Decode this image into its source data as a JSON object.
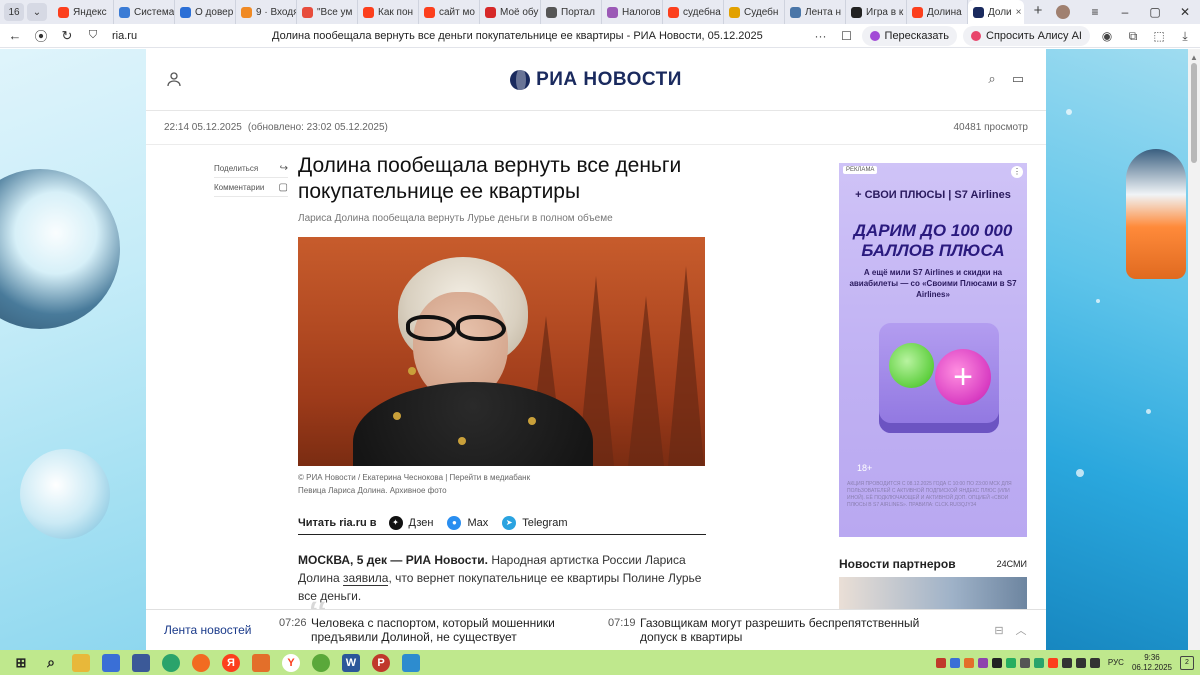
{
  "browser": {
    "tab_count": "16",
    "tabs": [
      {
        "label": "Яндекс",
        "color": "#fc3f1d"
      },
      {
        "label": "Система",
        "color": "#3a7bd5"
      },
      {
        "label": "О довер",
        "color": "#2b6fd6"
      },
      {
        "label": "9 · Входя",
        "color": "#f08a24"
      },
      {
        "label": "\"Все ум",
        "color": "#e74c3c"
      },
      {
        "label": "Как пон",
        "color": "#fc3f1d"
      },
      {
        "label": "сайт мо",
        "color": "#fc3f1d"
      },
      {
        "label": "Моё обу",
        "color": "#d62828"
      },
      {
        "label": "Портал",
        "color": "#555555"
      },
      {
        "label": "Налогов",
        "color": "#9b59b6"
      },
      {
        "label": "судебна",
        "color": "#fc3f1d"
      },
      {
        "label": "Судебн",
        "color": "#e2a100"
      },
      {
        "label": "Лента н",
        "color": "#4a76a8"
      },
      {
        "label": "Игра в к",
        "color": "#222222"
      },
      {
        "label": "Долина",
        "color": "#fc3f1d"
      }
    ],
    "active_tab": {
      "label": "Доли",
      "close": "×"
    },
    "new_tab": "+",
    "url": "ria.ru",
    "page_title": "Долина пообещала вернуть все деньги покупательнице ее квартиры - РИА Новости, 05.12.2025",
    "translate_label": "Пересказать",
    "alice_label": "Спросить Алису AI",
    "more": "···"
  },
  "site": {
    "logo_text": "РИА НОВОСТИ",
    "published": "22:14 05.12.2025",
    "updated": "(обновлено: 23:02 05.12.2025)",
    "views": "40481",
    "views_label": "просмотр",
    "share_label": "Поделиться",
    "comments_label": "Комментарии"
  },
  "article": {
    "title": "Долина пообещала вернуть все деньги покупательнице ее квартиры",
    "subtitle": "Лариса Долина пообещала вернуть Лурье деньги в полном объеме",
    "photo_credit": "© РИА Новости / Екатерина Чеснокова",
    "photo_link": "Перейти в медиабанк",
    "photo_caption": "Певица Лариса Долина. Архивное фото",
    "read_in_label": "Читать ria.ru в",
    "sources": [
      {
        "label": "Дзен",
        "color": "#111111"
      },
      {
        "label": "Max",
        "color": "#2a8ef0"
      },
      {
        "label": "Telegram",
        "color": "#2aa3e0"
      }
    ],
    "lead_bold": "МОСКВА, 5 дек — РИА Новости.",
    "lead_text_1": " Народная артистка России Лариса Долина ",
    "lead_link": "заявила",
    "lead_text_2": ", что вернет покупательнице ее квартиры Полине Лурье все деньги."
  },
  "ad": {
    "label": "РЕКЛАМА",
    "brands": "+ СВОИ ПЛЮСЫ  |  S7 Airlines",
    "headline": "ДАРИМ ДО 100 000 БАЛЛОВ ПЛЮСА",
    "sub": "А ещё мили S7 Airlines и скидки на авиабилеты — со «Своими Плюсами в S7 Airlines»",
    "age": "18+",
    "legal": "АКЦИЯ ПРОВОДИТСЯ С 08.12.2025 ГОДА С 10:00 ПО 23:00 МСК ДЛЯ ПОЛЬЗОВАТЕЛЕЙ С АКТИВНОЙ ПОДПИСКОЙ ЯНДЕКС ПЛЮС (ИЛИ ИНОЙ). ЕЁ ПОДКЛЮЧАЮЩЕЙ И АКТИВНОЙ ДОП. ОПЦИЕЙ «СВОИ ПЛЮСЫ В S7 AIRLINES». ПРАВИЛА: CLCK.RU/3QJY34"
  },
  "partners": {
    "title": "Новости партнеров",
    "source": "24СМИ"
  },
  "ticker": {
    "label": "Лента новостей",
    "items": [
      {
        "time": "07:26",
        "text": "Человека с паспортом, который мошенники предъявили Долиной, не существует"
      },
      {
        "time": "07:19",
        "text": "Газовщикам могут разрешить беспрепятственный допуск в квартиры"
      }
    ]
  },
  "taskbar": {
    "lang": "РУС",
    "time": "9:36",
    "date": "06.12.2025",
    "notifications": "2"
  }
}
